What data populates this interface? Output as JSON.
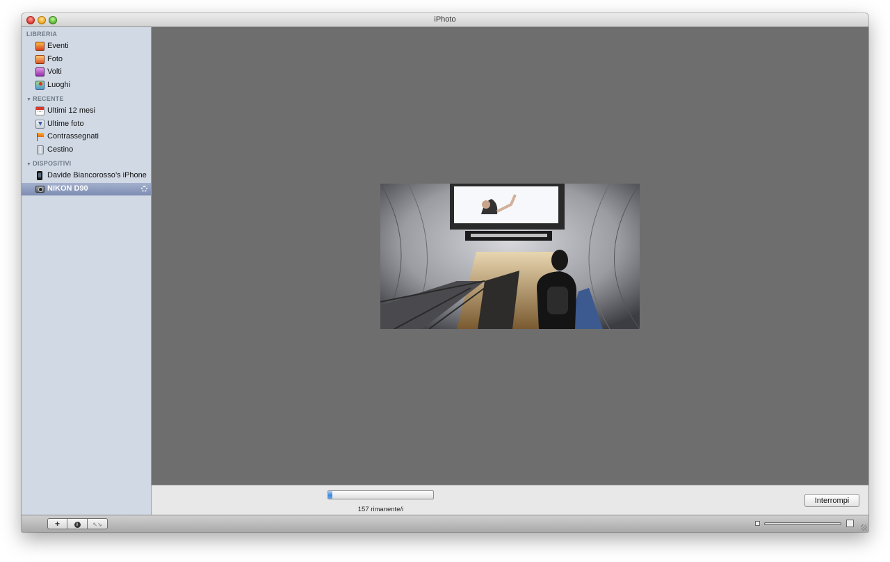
{
  "window": {
    "title": "iPhoto"
  },
  "sidebar": {
    "sections": [
      {
        "header": "LIBRERIA",
        "items": [
          {
            "label": "Eventi",
            "icon": "events-icon"
          },
          {
            "label": "Foto",
            "icon": "photos-icon"
          },
          {
            "label": "Volti",
            "icon": "faces-icon"
          },
          {
            "label": "Luoghi",
            "icon": "places-icon"
          }
        ]
      },
      {
        "header": "RECENTE",
        "items": [
          {
            "label": "Ultimi 12 mesi",
            "icon": "calendar-icon"
          },
          {
            "label": "Ultime foto",
            "icon": "import-icon"
          },
          {
            "label": "Contrassegnati",
            "icon": "flag-icon"
          },
          {
            "label": "Cestino",
            "icon": "trash-icon"
          }
        ]
      },
      {
        "header": "DISPOSITIVI",
        "items": [
          {
            "label": "Davide Biancorosso’s iPhone",
            "icon": "iphone-icon"
          },
          {
            "label": "NIKON D90",
            "icon": "camera-icon",
            "selected": true
          }
        ]
      }
    ]
  },
  "import": {
    "progress_fraction": 0.04,
    "remaining_label": "157 rimanente/i",
    "stop_label": "Interrompi"
  },
  "toolbar": {
    "add_label": "+",
    "info_label": "i",
    "fullscreen_label": "↖↘"
  },
  "colors": {
    "sidebar_bg": "#d1d9e4",
    "viewer_bg": "#6e6e6e",
    "selection": "#7c8cb2",
    "progress_fill": "#3d86dc"
  }
}
